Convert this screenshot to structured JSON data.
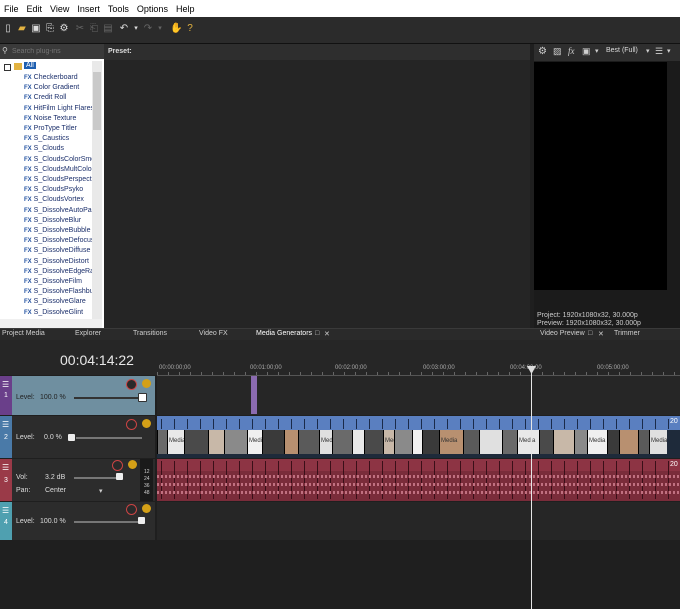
{
  "menu": [
    "File",
    "Edit",
    "View",
    "Insert",
    "Tools",
    "Options",
    "Help"
  ],
  "search": {
    "placeholder": "Search plug-ins"
  },
  "tree": {
    "root": "All",
    "items": [
      "Checkerboard",
      "Color Gradient",
      "Credit Roll",
      "HitFilm Light Flares",
      "Noise Texture",
      "ProType Titler",
      "S_Caustics",
      "S_Clouds",
      "S_CloudsColorSmo",
      "S_CloudsMultColor",
      "S_CloudsPerspecti",
      "S_CloudsPsyko",
      "S_CloudsVortex",
      "S_DissolveAutoPai",
      "S_DissolveBlur",
      "S_DissolveBubble",
      "S_DissolveDefocus",
      "S_DissolveDiffuse",
      "S_DissolveDistort",
      "S_DissolveEdgeRa",
      "S_DissolveFilm",
      "S_DissolveFlashbu",
      "S_DissolveGlare",
      "S_DissolveGlint"
    ]
  },
  "preset": {
    "label": "Preset:"
  },
  "preview": {
    "quality": "Best (Full)",
    "project": "Project:  1920x1080x32, 30.000p",
    "preview_line": "Preview:  1920x1080x32, 30.000p"
  },
  "tabs": [
    "Project Media",
    "Explorer",
    "Transitions",
    "Video FX",
    "Media Generators",
    "Video Preview",
    "Trimmer"
  ],
  "timeline": {
    "timecode": "00:04:14:22",
    "ticks": [
      "00:00:00;00",
      "00:01:00;00",
      "00:02:00;00",
      "00:03:00;00",
      "00:04:00;00",
      "00:05:00;00"
    ],
    "tracks": [
      {
        "label": "Level:",
        "value": "100.0 %"
      },
      {
        "label": "Level:",
        "value": "0.0 %"
      },
      {
        "label": "Vol:",
        "value": "3.2 dB",
        "pan_label": "Pan:",
        "pan_value": "Center"
      },
      {
        "label": "Level:",
        "value": "100.0 %"
      }
    ],
    "clip_label": "Media",
    "db_marks": [
      "12",
      "24",
      "36",
      "48"
    ],
    "track_ids": [
      "1",
      "2",
      "3",
      "4"
    ],
    "end_marker": "20"
  }
}
